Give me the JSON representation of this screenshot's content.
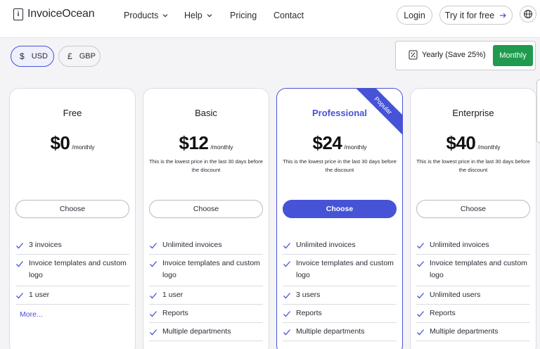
{
  "header": {
    "logo_mark": "i",
    "logo_text": "InvoiceOcean",
    "nav": {
      "products": "Products",
      "help": "Help",
      "pricing": "Pricing",
      "contact": "Contact"
    },
    "login": "Login",
    "try_free": "Try it for free"
  },
  "currency": {
    "usd": {
      "symbol": "$",
      "label": "USD"
    },
    "gbp": {
      "symbol": "£",
      "label": "GBP"
    }
  },
  "billing": {
    "yearly": "Yearly (Save 25%)",
    "monthly": "Monthly"
  },
  "colors": {
    "accent": "#4653d6",
    "monthly_active": "#1f9a4f"
  },
  "plans": [
    {
      "name": "Free",
      "price": "$0",
      "per": "/monthly",
      "note": "",
      "choose": "Choose",
      "features": [
        "3 invoices",
        "Invoice templates and custom logo",
        "1 user"
      ],
      "more": "More..."
    },
    {
      "name": "Basic",
      "price": "$12",
      "per": "/monthly",
      "note": "This is the lowest price in the last 30 days before the discount",
      "choose": "Choose",
      "features": [
        "Unlimited invoices",
        "Invoice templates and custom logo",
        "1 user",
        "Reports",
        "Multiple departments"
      ]
    },
    {
      "name": "Professional",
      "price": "$24",
      "per": "/monthly",
      "note": "This is the lowest price in the last 30 days before the discount",
      "choose": "Choose",
      "badge": "Popular",
      "features": [
        "Unlimited invoices",
        "Invoice templates and custom logo",
        "3 users",
        "Reports",
        "Multiple departments"
      ]
    },
    {
      "name": "Enterprise",
      "price": "$40",
      "per": "/monthly",
      "note": "This is the lowest price in the last 30 days before the discount",
      "choose": "Choose",
      "features": [
        "Unlimited invoices",
        "Invoice templates and custom logo",
        "Unlimited users",
        "Reports",
        "Multiple departments"
      ]
    }
  ]
}
